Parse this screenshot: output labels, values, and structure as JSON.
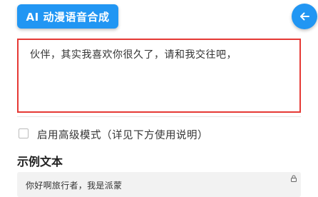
{
  "header": {
    "title": "AI 动漫语音合成",
    "back_icon": "arrow-left-icon",
    "accent_color": "#2196f3"
  },
  "input": {
    "value": "伙伴，其实我喜欢你很久了，请和我交往吧，",
    "highlight_color": "#e53935"
  },
  "advanced": {
    "checked": false,
    "label": "启用高级模式（详见下方使用说明）"
  },
  "sample": {
    "heading": "示例文本",
    "text": "你好啊旅行者，我是派蒙",
    "icon": "lock-icon"
  }
}
